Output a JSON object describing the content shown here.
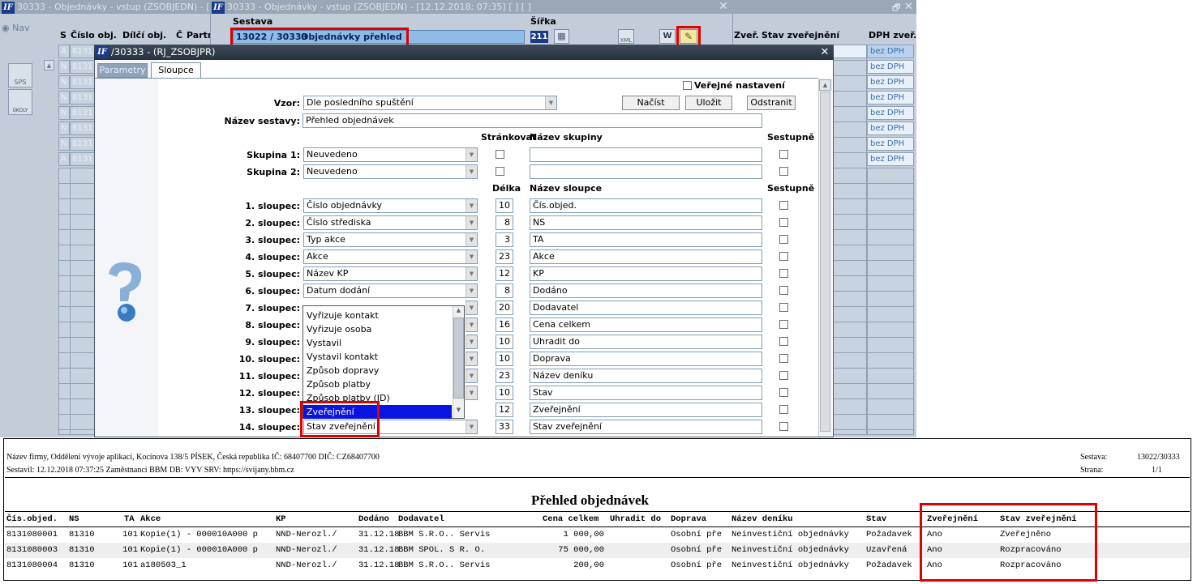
{
  "outer": {
    "title": "30333 - Objednávky - vstup (ZSOBJEDN) - [",
    "nav": "Nav",
    "sps": "SPS",
    "ukoly": "ÚKOLY",
    "columns": [
      "S",
      "Číslo obj.",
      "Dílčí obj.",
      "Č",
      "Partn"
    ],
    "rows": [
      {
        "s": "A",
        "c": "8131"
      },
      {
        "s": "N",
        "c": "8131"
      },
      {
        "s": "N",
        "c": "8131"
      },
      {
        "s": "N",
        "c": "8131"
      },
      {
        "s": "N",
        "c": "8131"
      },
      {
        "s": "N",
        "c": "8131"
      },
      {
        "s": "N",
        "c": "8131"
      },
      {
        "s": "A",
        "c": "8131"
      }
    ]
  },
  "mid": {
    "title": "30333 - Objednávky - vstup (ZSOBJEDN) - [12.12.2018; 07:35]  [  ]  [ ]",
    "sestava_label": "Sestava",
    "sestava_code": "13022 / 30333",
    "sestava_name": "Objednávky přehled",
    "sirka_label": "Šířka",
    "sirka_value": "211",
    "col_zver": "Zveř.",
    "col_stav": "Stav zveřejnění",
    "col_dph": "DPH zveř.",
    "dph_values": [
      "bez DPH",
      "bez DPH",
      "bez DPH",
      "bez DPH",
      "bez DPH",
      "bez DPH",
      "bez DPH",
      "bez DPH"
    ],
    "xml_label": "XML",
    "word_label": "W"
  },
  "dialog": {
    "title": "/30333 - (RJ_ZSOBJPR)",
    "tabs": [
      "Parametry",
      "Sloupce"
    ],
    "verejne_label": "Veřejné nastavení",
    "vzor_label": "Vzor:",
    "vzor_value": "Dle posledního spuštění",
    "btn_nacist": "Načíst",
    "btn_ulozit": "Uložit",
    "btn_odstranit": "Odstranit",
    "nazev_label": "Název sestavy:",
    "nazev_value": "Přehled objednávek",
    "hdr_strankovat": "Stránkovat",
    "hdr_nazev_skupiny": "Název skupiny",
    "hdr_sestupne": "Sestupně",
    "skupina1_label": "Skupina 1:",
    "skupina1_value": "Neuvedeno",
    "skupina2_label": "Skupina 2:",
    "skupina2_value": "Neuvedeno",
    "hdr_delka": "Délka",
    "hdr_nazev_sloupce": "Název sloupce",
    "hdr_sestupne2": "Sestupně",
    "columns": [
      {
        "label": "1. sloupec:",
        "value": "Číslo objednávky",
        "len": "10",
        "name": "Čís.objed."
      },
      {
        "label": "2. sloupec:",
        "value": "Číslo střediska",
        "len": "8",
        "name": "NS"
      },
      {
        "label": "3. sloupec:",
        "value": "Typ akce",
        "len": "3",
        "name": "TA"
      },
      {
        "label": "4. sloupec:",
        "value": "Akce",
        "len": "23",
        "name": "Akce"
      },
      {
        "label": "5. sloupec:",
        "value": "Název KP",
        "len": "12",
        "name": "KP"
      },
      {
        "label": "6. sloupec:",
        "value": "Datum dodání",
        "len": "8",
        "name": "Dodáno"
      },
      {
        "label": "7. sloupec:",
        "value": "",
        "len": "20",
        "name": "Dodavatel"
      },
      {
        "label": "8. sloupec:",
        "value": "",
        "len": "16",
        "name": "Cena celkem"
      },
      {
        "label": "9. sloupec:",
        "value": "",
        "len": "10",
        "name": "Uhradit do"
      },
      {
        "label": "10. sloupec:",
        "value": "",
        "len": "10",
        "name": "Doprava"
      },
      {
        "label": "11. sloupec:",
        "value": "",
        "len": "23",
        "name": "Název deníku"
      },
      {
        "label": "12. sloupec:",
        "value": "",
        "len": "10",
        "name": "Stav"
      },
      {
        "label": "13. sloupec:",
        "value": "Zveřejnění",
        "len": "12",
        "name": "Zveřejnění"
      },
      {
        "label": "14. sloupec:",
        "value": "Stav zveřejnění",
        "len": "33",
        "name": "Stav zveřejnění"
      }
    ],
    "dropdown_options": [
      "Vyřizuje kontakt",
      "Vyřizuje osoba",
      "Vystavil",
      "Vystavil kontakt",
      "Způsob dopravy",
      "Způsob platby",
      "Způsob platby (ID)",
      "Zveřejnění"
    ]
  },
  "report": {
    "company": "Název firmy, Oddělení vývoje aplikací, Kocínova 138/5 PÍSEK, Česká republika  IČ: 68407700  DIČ: CZ68407700",
    "sestavil": "Sestavil: 12.12.2018 07:37:25 Zaměstnanci BBM  DB: VYV  SRV: https://svijany.bbm.cz",
    "sestava_label": "Sestava:",
    "sestava_value": "13022/30333",
    "strana_label": "Strana:",
    "strana_value": "1/1",
    "title": "Přehled objednávek",
    "headers": [
      "Čís.objed.",
      "NS",
      "TA",
      "Akce",
      "KP",
      "Dodáno",
      "Dodavatel",
      "Cena celkem",
      "Uhradit do",
      "Doprava",
      "Název deníku",
      "Stav",
      "Zveřejnění",
      "Stav zveřejnění"
    ],
    "rows": [
      [
        "8131080001",
        "81310",
        "101",
        "Kopie(1) - 000010A000 p",
        "NND-Nerozl./",
        "31.12.18",
        "BBM S.R.O.. Servis",
        "1 000,00",
        "",
        "Osobní pře",
        "Neinvestiční objednávky",
        "Požadavek",
        "Ano",
        "Zveřejněno"
      ],
      [
        "8131080003",
        "81310",
        "101",
        "Kopie(1) - 000010A000 p",
        "NND-Nerozl./",
        "31.12.18",
        "BBM SPOL. S R. O.",
        "75 000,00",
        "",
        "Osobní pře",
        "Neinvestiční objednávky",
        "Uzavřená",
        "Ano",
        "Rozpracováno"
      ],
      [
        "8131080004",
        "81310",
        "101",
        "a180503_1",
        "NND-Nerozl./",
        "31.12.18",
        "BBM S.R.O.. Servis",
        "200,00",
        "",
        "Osobní pře",
        "Neinvestiční objednávky",
        "Požadavek",
        "Ano",
        "Rozpracováno"
      ]
    ]
  }
}
